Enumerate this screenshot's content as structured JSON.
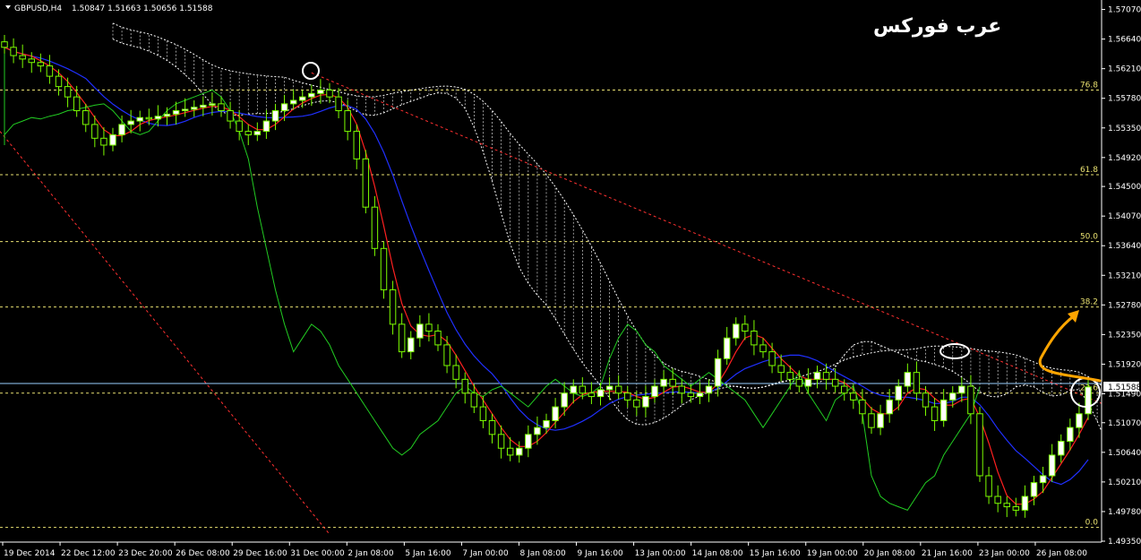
{
  "header": {
    "symbol": "GBPUSD,H4",
    "ohlc": "1.50847 1.51663 1.50656 1.51588"
  },
  "brand_text": "عرب فوركس",
  "colors": {
    "background": "#000000",
    "candle": "#7CFC00",
    "bull_body": "#ffffff",
    "tenkan": "#ff2020",
    "kijun": "#2030ff",
    "chikou": "#22cc22",
    "cloud": "#ffffff",
    "fib_line": "#e8e070",
    "trend_line": "#ff3030",
    "arrow": "#ffa500",
    "current_price_line": "#9ad0ff"
  },
  "chart_data": {
    "type": "candlestick",
    "symbol": "GBPUSD",
    "timeframe": "H4",
    "ylim": [
      1.4935,
      1.5709
    ],
    "y_ticks": [
      "1.57070",
      "1.56640",
      "1.56210",
      "1.55780",
      "1.55350",
      "1.54920",
      "1.54500",
      "1.54070",
      "1.53640",
      "1.53210",
      "1.52780",
      "1.52350",
      "1.51920",
      "1.51490",
      "1.51070",
      "1.50640",
      "1.50210",
      "1.49780",
      "1.49350"
    ],
    "x_labels": [
      "19 Dec 2014",
      "22 Dec 12:00",
      "23 Dec 20:00",
      "26 Dec 08:00",
      "29 Dec 16:00",
      "31 Dec 00:00",
      "2 Jan 08:00",
      "5 Jan 16:00",
      "7 Jan 00:00",
      "8 Jan 08:00",
      "9 Jan 16:00",
      "13 Jan 00:00",
      "14 Jan 08:00",
      "15 Jan 16:00",
      "19 Jan 00:00",
      "20 Jan 08:00",
      "21 Jan 16:00",
      "23 Jan 00:00",
      "26 Jan 08:00"
    ],
    "current_price": "1.51588",
    "fibonacci": [
      {
        "label": "76.8",
        "value": 1.559
      },
      {
        "label": "61.8",
        "value": 1.5467
      },
      {
        "label": "50.0",
        "value": 1.537
      },
      {
        "label": "38.2",
        "value": 1.5275
      },
      {
        "label": "23.6",
        "value": 1.515
      },
      {
        "label": "0.0",
        "value": 1.4955
      }
    ],
    "close": [
      1.5652,
      1.564,
      1.5635,
      1.563,
      1.5625,
      1.561,
      1.5595,
      1.558,
      1.556,
      1.554,
      1.552,
      1.551,
      1.5525,
      1.554,
      1.5545,
      1.555,
      1.5548,
      1.5552,
      1.5555,
      1.556,
      1.5562,
      1.5565,
      1.5568,
      1.557,
      1.556,
      1.5545,
      1.553,
      1.5525,
      1.553,
      1.5545,
      1.556,
      1.557,
      1.5575,
      1.558,
      1.5585,
      1.559,
      1.558,
      1.556,
      1.553,
      1.549,
      1.542,
      1.536,
      1.53,
      1.525,
      1.521,
      1.523,
      1.525,
      1.524,
      1.522,
      1.519,
      1.517,
      1.515,
      1.513,
      1.511,
      1.509,
      1.507,
      1.506,
      1.507,
      1.509,
      1.51,
      1.511,
      1.513,
      1.515,
      1.516,
      1.515,
      1.5145,
      1.5155,
      1.516,
      1.515,
      1.514,
      1.513,
      1.5145,
      1.516,
      1.517,
      1.516,
      1.515,
      1.5145,
      1.515,
      1.516,
      1.52,
      1.523,
      1.525,
      1.524,
      1.522,
      1.521,
      1.519,
      1.518,
      1.517,
      1.516,
      1.517,
      1.518,
      1.517,
      1.516,
      1.515,
      1.514,
      1.512,
      1.51,
      1.512,
      1.514,
      1.516,
      1.518,
      1.515,
      1.513,
      1.511,
      1.514,
      1.515,
      1.516,
      1.512,
      1.503,
      1.5,
      1.499,
      1.4985,
      1.498,
      1.5,
      1.502,
      1.503,
      1.506,
      1.508,
      1.51,
      1.512,
      1.5159
    ]
  }
}
